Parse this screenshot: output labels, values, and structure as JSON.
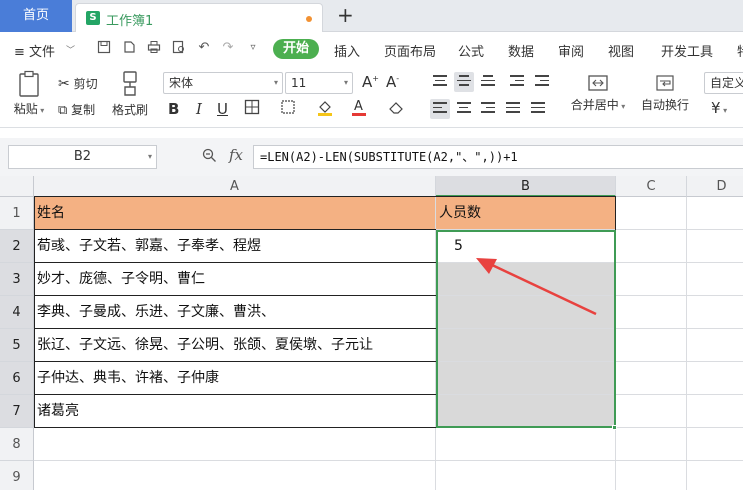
{
  "tabs": {
    "home": "首页",
    "workbook": "工作簿1",
    "workbook_icon": "S",
    "add": "+"
  },
  "menu": {
    "file": "≡ 文件",
    "start": "开始",
    "items": [
      "插入",
      "页面布局",
      "公式",
      "数据",
      "审阅",
      "视图",
      "开发工具",
      "特"
    ]
  },
  "ribbon": {
    "paste": "粘贴",
    "cut": "剪切",
    "copy": "复制",
    "format_painter": "格式刷",
    "font_name": "宋体",
    "font_size": "11",
    "merge_center": "合并居中",
    "auto_wrap": "自动换行",
    "custom": "自定义",
    "currency": "¥"
  },
  "formula_bar": {
    "name_box": "B2",
    "formula": "=LEN(A2)-LEN(SUBSTITUTE(A2,\"、\",))+1"
  },
  "columns": [
    "A",
    "B",
    "C",
    "D"
  ],
  "rows": [
    "1",
    "2",
    "3",
    "4",
    "5",
    "6",
    "7",
    "8",
    "9"
  ],
  "cells": {
    "A1": "姓名",
    "B1": "人员数",
    "A2": "荀彧、子文若、郭嘉、子奉孝、程煜",
    "B2": "5",
    "A3": "妙才、庞德、子令明、曹仁",
    "A4": "李典、子曼成、乐进、子文廉、曹洪、",
    "A5": "张辽、子文远、徐晃、子公明、张颌、夏侯墩、子元让",
    "A6": "子仲达、典韦、许褚、子仲康",
    "A7": "诸葛亮"
  },
  "colors": {
    "header_fill": "#f4b183",
    "selection_border": "#3f9b55",
    "arrow": "#e8423f",
    "accent": "#4caf50"
  }
}
